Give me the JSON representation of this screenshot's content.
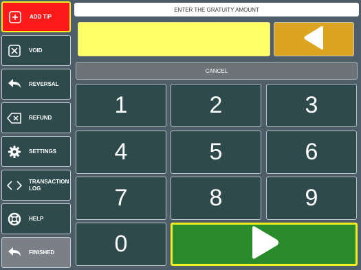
{
  "sidebar": {
    "items": [
      {
        "label": "ADD TIP",
        "icon": "plus-square-icon"
      },
      {
        "label": "VOID",
        "icon": "x-square-icon"
      },
      {
        "label": "REVERSAL",
        "icon": "undo-arrow-icon"
      },
      {
        "label": "REFUND",
        "icon": "backspace-icon"
      },
      {
        "label": "SETTINGS",
        "icon": "gear-icon"
      },
      {
        "label": "TRANSACTION LOG",
        "icon": "code-brackets-icon"
      },
      {
        "label": "HELP",
        "icon": "lifebuoy-icon"
      },
      {
        "label": "FINISHED",
        "icon": "undo-arrow-icon"
      }
    ]
  },
  "header": {
    "title": "ENTER THE GRATUITY AMOUNT"
  },
  "entry": {
    "value": ""
  },
  "cancel_label": "CANCEL",
  "keypad": {
    "k1": "1",
    "k2": "2",
    "k3": "3",
    "k4": "4",
    "k5": "5",
    "k6": "6",
    "k7": "7",
    "k8": "8",
    "k9": "9",
    "k0": "0"
  },
  "colors": {
    "active": "#ff1a1a",
    "highlight": "#f6ee24",
    "key": "#2f4a4c",
    "entry": "#ffff66",
    "backspace": "#dba520",
    "enter": "#2a8b2a"
  }
}
